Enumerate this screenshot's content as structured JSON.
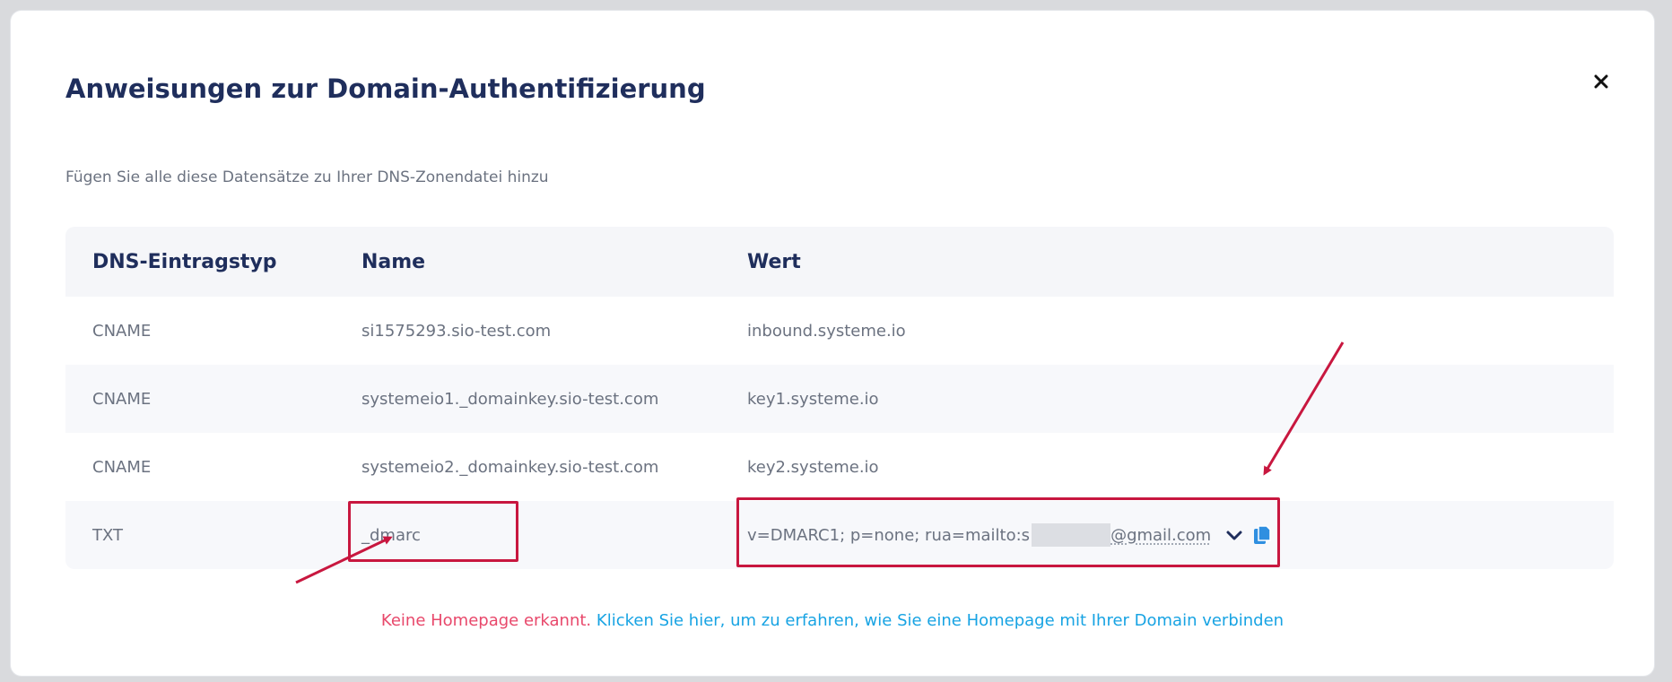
{
  "modal": {
    "title": "Anweisungen zur Domain-Authentifizierung",
    "close_icon": "close-icon",
    "subtitle": "Fügen Sie alle diese Datensätze zu Ihrer DNS-Zonendatei hinzu"
  },
  "table": {
    "headers": [
      "DNS-Eintragstyp",
      "Name",
      "Wert"
    ],
    "rows": [
      {
        "type": "CNAME",
        "name": "si1575293.sio-test.com",
        "value": "inbound.systeme.io"
      },
      {
        "type": "CNAME",
        "name": "systemeio1._domainkey.sio-test.com",
        "value": "key1.systeme.io"
      },
      {
        "type": "CNAME",
        "name": "systemeio2._domainkey.sio-test.com",
        "value": "key2.systeme.io"
      },
      {
        "type": "TXT",
        "name": "_dmarc",
        "value_prefix": "v=DMARC1; p=none; rua=mailto:s",
        "value_suffix": "@gmail.com"
      }
    ],
    "expand_icon": "chevron-down-icon",
    "copy_icon": "copy-icon"
  },
  "footer": {
    "warning": "Keine Homepage erkannt.",
    "link": "Klicken Sie hier, um zu erfahren, wie Sie eine Homepage mit Ihrer Domain verbinden"
  },
  "colors": {
    "title": "#1f2e5c",
    "text_muted": "#6b7280",
    "annotation_red": "#c8173f",
    "warning": "#e8486b",
    "link": "#17a3e3",
    "copy_icon": "#2f8fe0"
  }
}
